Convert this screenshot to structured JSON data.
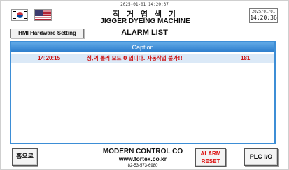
{
  "status_bar": {
    "timestamp": "2025-01-01 14:20:37"
  },
  "header": {
    "flags": [
      "korea-flag-icon",
      "usa-flag-icon"
    ],
    "title_ko": "직 거 염 색 기",
    "title_en": "JIGGER DYEING MACHINE",
    "date": "2025/01/01",
    "time": "14:20:36"
  },
  "toolbar": {
    "hmi_setting_label": "HMI Hardware Setting"
  },
  "page": {
    "title": "ALARM LIST"
  },
  "alarm_list": {
    "caption": "Caption",
    "rows": [
      {
        "time": "14:20:15",
        "message": "정,역 롤러 모드 0 입니다. 자동작업 불가!!",
        "code": "181"
      }
    ]
  },
  "footer": {
    "home_label": "홈으로",
    "company_name": "MODERN CONTROL CO",
    "company_url": "www.fortex.co.kr",
    "company_tel": "82-53-573-6980",
    "alarm_reset_line1": "ALARM",
    "alarm_reset_line2": "RESET",
    "plc_io_label": "PLC I/O"
  },
  "colors": {
    "caption_bar": "#2b7ccb",
    "alarm_text": "#cc1111",
    "row_highlight": "#dbe9f7"
  }
}
